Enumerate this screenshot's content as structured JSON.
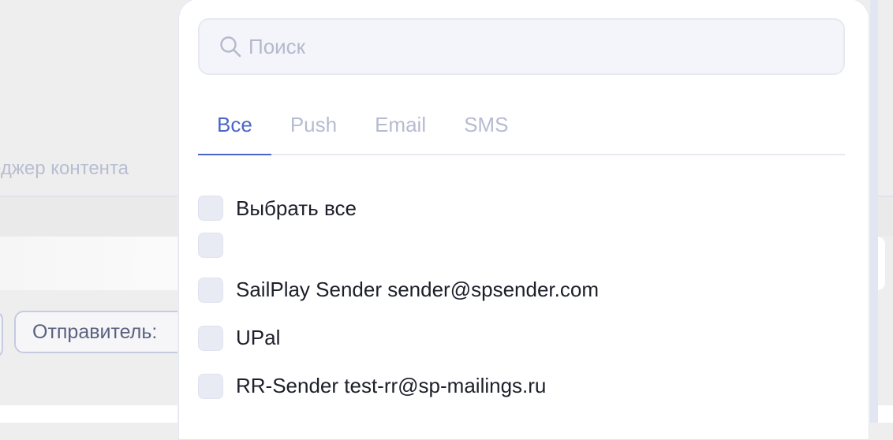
{
  "background": {
    "tab_label_partial": "еджер контента",
    "sender_filter_label": "Отправитель:"
  },
  "dropdown": {
    "search": {
      "placeholder": "Поиск",
      "value": "",
      "icon": "search-icon"
    },
    "tabs": [
      {
        "label": "Все",
        "active": true
      },
      {
        "label": "Push",
        "active": false
      },
      {
        "label": "Email",
        "active": false
      },
      {
        "label": "SMS",
        "active": false
      }
    ],
    "select_all_label": "Выбрать все",
    "options": [
      {
        "label": "",
        "checked": false
      },
      {
        "label": "SailPlay Sender sender@spsender.com",
        "checked": false
      },
      {
        "label": "UPal",
        "checked": false
      },
      {
        "label": "RR-Sender test-rr@sp-mailings.ru",
        "checked": false
      }
    ]
  },
  "colors": {
    "accent": "#4a66c9",
    "muted_text": "#b6bcd0",
    "checkbox_bg": "#e8eaf4"
  }
}
